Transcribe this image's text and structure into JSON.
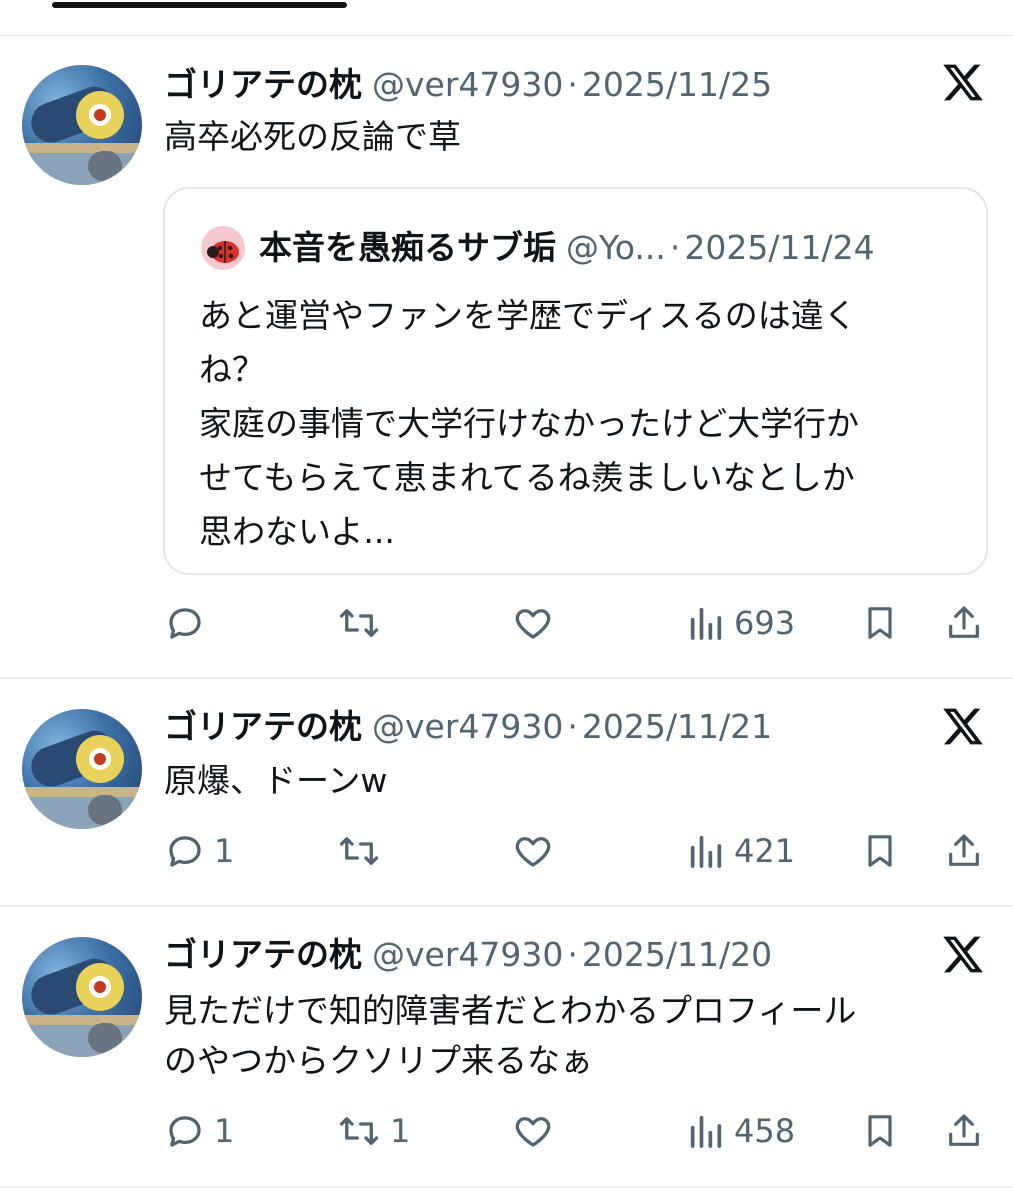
{
  "tweets": [
    {
      "name": "ゴリアテの枕",
      "handle": "@ver47930",
      "separator": "·",
      "date": "2025/11/25",
      "text_lines": [
        "高卒必死の反論で草"
      ],
      "quote": {
        "name": "本音を愚痴るサブ垢",
        "handle": "@Yo...",
        "separator": "·",
        "date": "2025/11/24",
        "avatar_icon": "ladybug-icon",
        "text_lines": [
          "あと運営やファンを学歴でディスるのは違く",
          "ね？",
          "家庭の事情で大学行けなかったけど大学行か",
          "せてもらえて恵まれてるね羨ましいなとしか",
          "思わないよ..."
        ]
      },
      "replies": "",
      "retweets": "",
      "views": "693"
    },
    {
      "name": "ゴリアテの枕",
      "handle": "@ver47930",
      "separator": "·",
      "date": "2025/11/21",
      "text_lines": [
        "原爆、ドーンw"
      ],
      "replies": "1",
      "retweets": "",
      "views": "421"
    },
    {
      "name": "ゴリアテの枕",
      "handle": "@ver47930",
      "separator": "·",
      "date": "2025/11/20",
      "text_lines": [
        "見ただけで知的障害者だとわかるプロフィール",
        "のやつからクソリプ来るなぁ"
      ],
      "replies": "1",
      "retweets": "1",
      "views": "458"
    }
  ],
  "colors": {
    "text": "#0f1419",
    "secondary": "#536471",
    "border": "#e3e7ea"
  }
}
